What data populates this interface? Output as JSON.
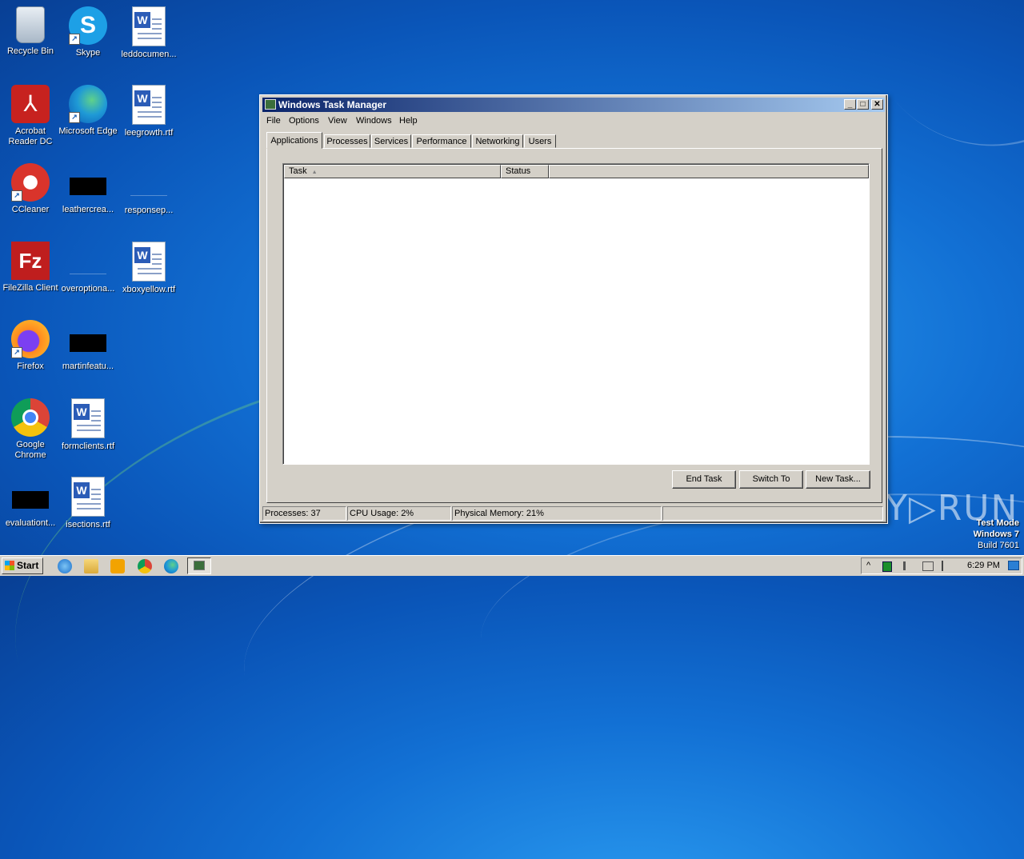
{
  "desktop": {
    "icons": [
      {
        "label": "Recycle Bin"
      },
      {
        "label": "Skype"
      },
      {
        "label": "leddocumen..."
      },
      {
        "label": "Acrobat Reader DC"
      },
      {
        "label": "Microsoft Edge"
      },
      {
        "label": "leegrowth.rtf"
      },
      {
        "label": "CCleaner"
      },
      {
        "label": "leathercrea..."
      },
      {
        "label": "responsep..."
      },
      {
        "label": "FileZilla Client"
      },
      {
        "label": "overoptiona..."
      },
      {
        "label": "xboxyellow.rtf"
      },
      {
        "label": "Firefox"
      },
      {
        "label": "martinfeatu..."
      },
      {
        "label": "Google Chrome"
      },
      {
        "label": "formclients.rtf"
      },
      {
        "label": "evaluationt..."
      },
      {
        "label": "isections.rtf"
      }
    ],
    "glyphs": {
      "skype": "S",
      "word": "W",
      "acrobat": "⅄",
      "filezilla": "Fz",
      "shortcut": "↗"
    }
  },
  "window": {
    "title": "Windows Task Manager",
    "controls": {
      "minimize": "_",
      "maximize": "□",
      "close": "✕"
    },
    "menu": [
      "File",
      "Options",
      "View",
      "Windows",
      "Help"
    ],
    "tabs": [
      "Applications",
      "Processes",
      "Services",
      "Performance",
      "Networking",
      "Users"
    ],
    "active_tab": "Applications",
    "columns": [
      "Task",
      "Status"
    ],
    "sort_indicator": "▲",
    "buttons": {
      "end_task": "End Task",
      "switch_to": "Switch To",
      "new_task": "New Task..."
    },
    "status": {
      "processes": "Processes: 37",
      "cpu": "CPU Usage: 2%",
      "memory": "Physical Memory: 21%"
    }
  },
  "watermark": "ANY▷RUN",
  "test_mode": {
    "line1": "Test Mode",
    "line2": "Windows 7",
    "line3": "Build 7601"
  },
  "taskbar": {
    "start_label": "Start",
    "tray_chevron": "^",
    "clock": "6:29 PM"
  }
}
